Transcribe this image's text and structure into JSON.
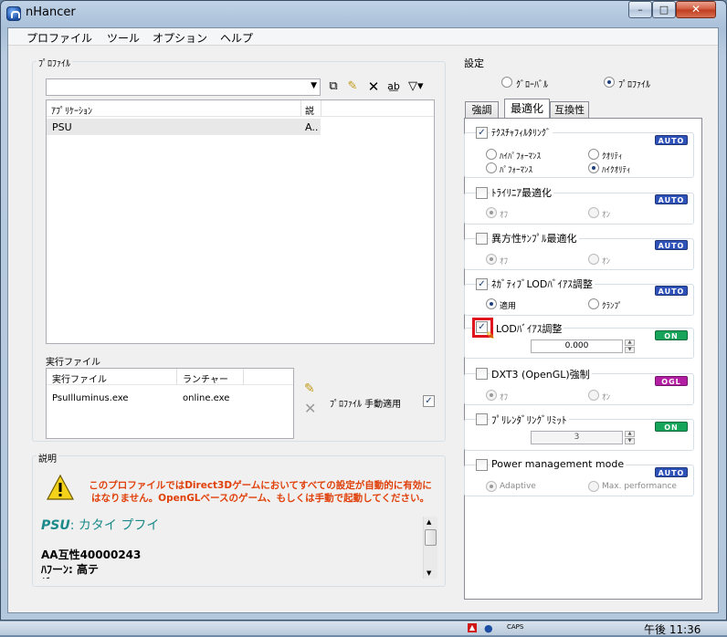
{
  "window": {
    "title": "nHancer",
    "min": "–",
    "max": "□",
    "close": "✕"
  },
  "menu": [
    "プロファイル",
    "ツール",
    "オプション",
    "ヘルプ"
  ],
  "profiles": {
    "group_label": "ﾌﾟﾛﾌｧｲﾙ",
    "combo_value": "",
    "columns": [
      "ｱﾌﾟﾘｹｰｼｮﾝ",
      "説"
    ],
    "rows": [
      {
        "app": "PSU",
        "desc": "A.."
      }
    ]
  },
  "executables": {
    "group_label": "実行ファイル",
    "columns": [
      "実行ファイル",
      "ランチャー"
    ],
    "rows": [
      {
        "file": "PsuIlluminus.exe",
        "launcher": "online.exe"
      }
    ],
    "manual_apply_label": "ﾌﾟﾛﾌｧｲﾙ 手動適用",
    "manual_apply_checked": true
  },
  "description": {
    "group_label": "説明",
    "warning": "このプロファイルではDirect3Dゲームにおいてすべての設定が自動的に有効に\nはなりません。OpenGLベースのゲーム、もしくは手動で起動してください。",
    "profile_name": "PSU",
    "profile_suffix": ": カタイ プフイ",
    "line1": "AA互性40000243",
    "line2": "ﾊﾌーﾝ: 高テ",
    "line3": "ﾀﾞ ﾖﾌ ｴﾌ"
  },
  "settings": {
    "group_label": "設定",
    "scope_options": [
      "ｸﾞﾛｰﾊﾞﾙ",
      "ﾌﾟﾛﾌｧｲﾙ"
    ],
    "scope_selected": "ﾌﾟﾛﾌｧｲﾙ",
    "tabs": [
      "強調",
      "最適化",
      "互換性"
    ],
    "active_tab": "最適化",
    "items": [
      {
        "title": "ﾃｸｽﾁｬﾌｨﾙﾀﾘﾝｸﾞ",
        "checked": true,
        "badge": "AUTO",
        "badge_color": "#2f52b8",
        "options": [
          "ﾊｲﾊﾟﾌｫｰﾏﾝｽ",
          "ｸｵﾘﾃｨ",
          "ﾊﾟﾌｫｰﾏﾝｽ",
          "ﾊｲｸｵﾘﾃｨ"
        ],
        "selected": "ﾊｲｸｵﾘﾃｨ"
      },
      {
        "title": "ﾄﾗｲﾘﾆｱ最適化",
        "checked": false,
        "badge": "AUTO",
        "badge_color": "#2f52b8",
        "options": [
          "ｵﾌ",
          "ｵﾝ"
        ],
        "selected": "ｵﾌ"
      },
      {
        "title": "異方性ｻﾝﾌﾟﾙ最適化",
        "checked": false,
        "badge": "AUTO",
        "badge_color": "#2f52b8",
        "options": [
          "ｵﾌ",
          "ｵﾝ"
        ],
        "selected": "ｵﾌ"
      },
      {
        "title": "ﾈｶﾞﾃｨﾌﾞLODﾊﾞｲｱｽ調整",
        "checked": true,
        "badge": "AUTO",
        "badge_color": "#2f52b8",
        "options": [
          "適用",
          "ｸﾗﾝﾌﾟ"
        ],
        "selected": "適用"
      },
      {
        "title": "LODﾊﾞｲｱｽ調整",
        "checked": true,
        "badge": "ON",
        "badge_color": "#16a35a",
        "value": "0.000"
      },
      {
        "title": "DXT3 (OpenGL)強制",
        "checked": false,
        "badge": "OGL",
        "badge_color": "#b21fa3",
        "options": [
          "ｵﾌ",
          "ｵﾝ"
        ],
        "selected": "ｵﾌ"
      },
      {
        "title": "ﾌﾟﾘﾚﾝﾀﾞﾘﾝｸﾞﾘﾐｯﾄ",
        "checked": false,
        "badge": "ON",
        "badge_color": "#16a35a",
        "value": "3"
      },
      {
        "title": "Power management mode",
        "checked": false,
        "badge": "AUTO",
        "badge_color": "#2f52b8",
        "options": [
          "Adaptive",
          "Max. performance"
        ],
        "selected": "Adaptive"
      }
    ]
  },
  "taskbar": {
    "indicator": "CAPS",
    "clock": "午後 11:36"
  }
}
